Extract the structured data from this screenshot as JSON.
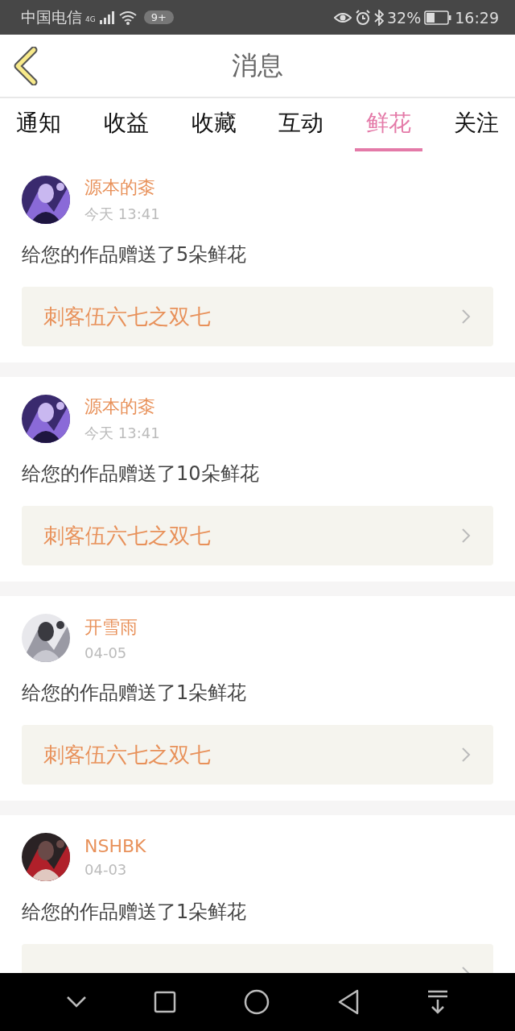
{
  "status_bar": {
    "carrier": "中国电信",
    "network": "4G",
    "notification_count": "9+",
    "battery_percent": "32%",
    "time": "16:29"
  },
  "header": {
    "title": "消息"
  },
  "tabs": [
    {
      "label": "通知",
      "selected": false
    },
    {
      "label": "收益",
      "selected": false
    },
    {
      "label": "收藏",
      "selected": false
    },
    {
      "label": "互动",
      "selected": false
    },
    {
      "label": "鲜花",
      "selected": true
    },
    {
      "label": "关注",
      "selected": false
    }
  ],
  "messages": [
    {
      "user": "源本的桼",
      "time": "今天 13:41",
      "text": "给您的作品赠送了5朵鲜花",
      "work": "刺客伍六七之双七"
    },
    {
      "user": "源本的桼",
      "time": "今天 13:41",
      "text": "给您的作品赠送了10朵鲜花",
      "work": "刺客伍六七之双七"
    },
    {
      "user": "开雪雨",
      "time": "04-05",
      "text": "给您的作品赠送了1朵鲜花",
      "work": "刺客伍六七之双七"
    },
    {
      "user": "NSHBK",
      "time": "04-03",
      "text": "给您的作品赠送了1朵鲜花"
    }
  ]
}
